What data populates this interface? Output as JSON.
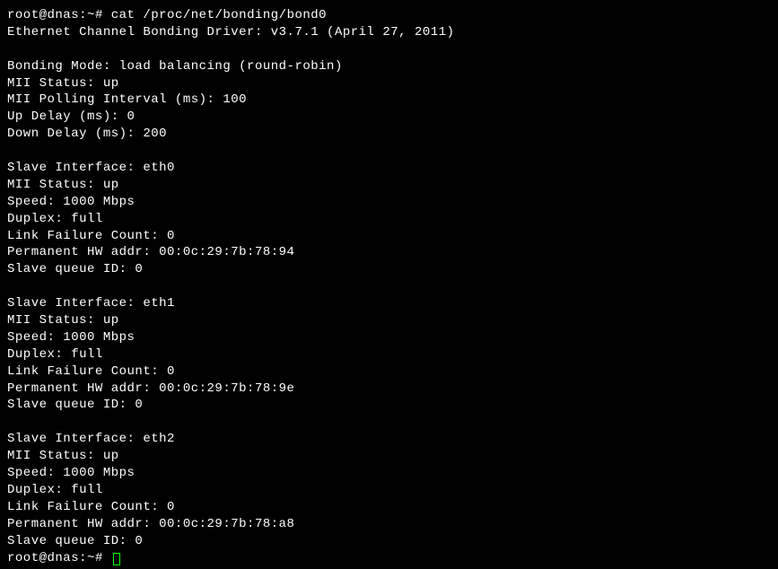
{
  "prompt1": {
    "user_host": "root@dnas",
    "separator": ":",
    "path": "~",
    "symbol": "#",
    "command": "cat /proc/net/bonding/bond0"
  },
  "output": {
    "driver_line": "Ethernet Channel Bonding Driver: v3.7.1 (April 27, 2011)",
    "header": {
      "bonding_mode": "Bonding Mode: load balancing (round-robin)",
      "mii_status": "MII Status: up",
      "mii_polling": "MII Polling Interval (ms): 100",
      "up_delay": "Up Delay (ms): 0",
      "down_delay": "Down Delay (ms): 200"
    },
    "slaves": [
      {
        "interface": "Slave Interface: eth0",
        "mii_status": "MII Status: up",
        "speed": "Speed: 1000 Mbps",
        "duplex": "Duplex: full",
        "link_failure": "Link Failure Count: 0",
        "hw_addr": "Permanent HW addr: 00:0c:29:7b:78:94",
        "queue_id": "Slave queue ID: 0"
      },
      {
        "interface": "Slave Interface: eth1",
        "mii_status": "MII Status: up",
        "speed": "Speed: 1000 Mbps",
        "duplex": "Duplex: full",
        "link_failure": "Link Failure Count: 0",
        "hw_addr": "Permanent HW addr: 00:0c:29:7b:78:9e",
        "queue_id": "Slave queue ID: 0"
      },
      {
        "interface": "Slave Interface: eth2",
        "mii_status": "MII Status: up",
        "speed": "Speed: 1000 Mbps",
        "duplex": "Duplex: full",
        "link_failure": "Link Failure Count: 0",
        "hw_addr": "Permanent HW addr: 00:0c:29:7b:78:a8",
        "queue_id": "Slave queue ID: 0"
      }
    ]
  },
  "prompt2": {
    "user_host": "root@dnas",
    "separator": ":",
    "path": "~",
    "symbol": "#"
  }
}
